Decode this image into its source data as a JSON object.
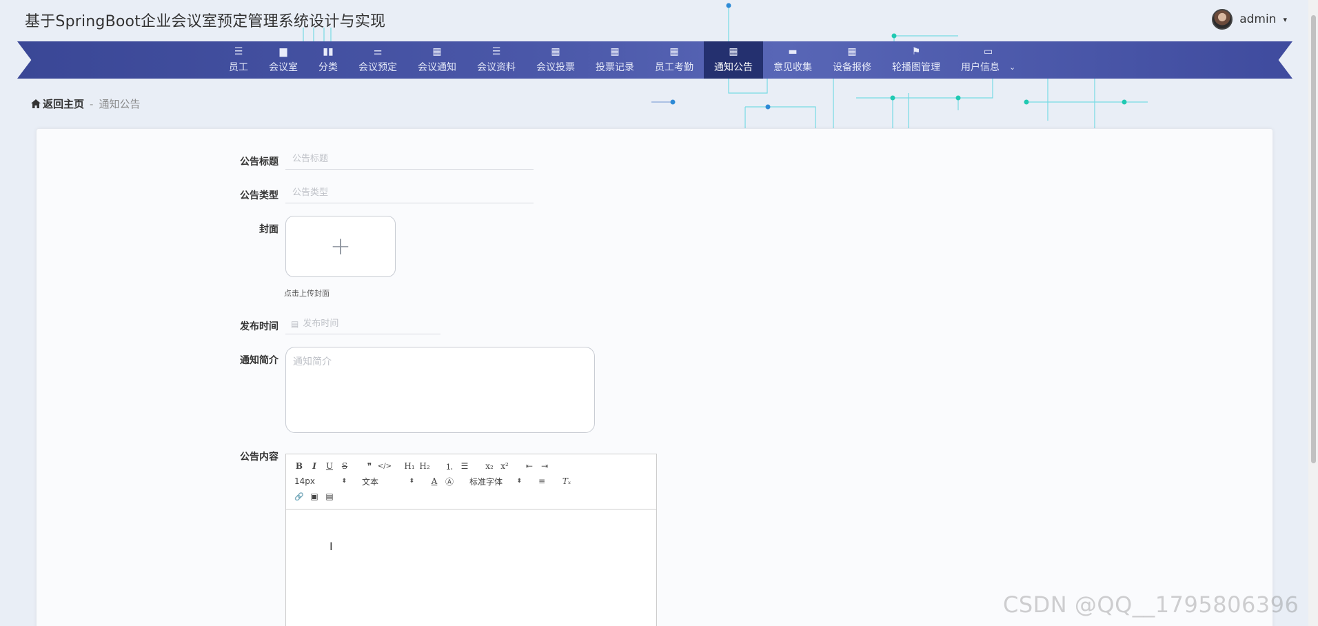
{
  "header": {
    "site_title": "基于SpringBoot企业会议室预定管理系统设计与实现",
    "username": "admin",
    "username_caret": "▾"
  },
  "nav": {
    "items": [
      {
        "label": "员工",
        "icon": "list-icon",
        "glyph": "☰"
      },
      {
        "label": "会议室",
        "icon": "chat-icon",
        "glyph": "▆"
      },
      {
        "label": "分类",
        "icon": "bar-chart-icon",
        "glyph": "▮▮"
      },
      {
        "label": "会议预定",
        "icon": "sliders-icon",
        "glyph": "⚌"
      },
      {
        "label": "会议通知",
        "icon": "grid-icon",
        "glyph": "▦"
      },
      {
        "label": "会议资料",
        "icon": "list-icon",
        "glyph": "☰"
      },
      {
        "label": "会议投票",
        "icon": "grid-icon",
        "glyph": "▦"
      },
      {
        "label": "投票记录",
        "icon": "grid-icon",
        "glyph": "▦"
      },
      {
        "label": "员工考勤",
        "icon": "grid-icon",
        "glyph": "▦"
      },
      {
        "label": "通知公告",
        "icon": "grid-icon",
        "glyph": "▦",
        "active": true
      },
      {
        "label": "意见收集",
        "icon": "briefcase-icon",
        "glyph": "▬"
      },
      {
        "label": "设备报修",
        "icon": "grid-icon",
        "glyph": "▦"
      },
      {
        "label": "轮播图管理",
        "icon": "flag-icon",
        "glyph": "⚑"
      },
      {
        "label": "用户信息",
        "icon": "window-icon",
        "glyph": "▭",
        "has_dropdown": true
      }
    ],
    "dropdown_caret": "⌄"
  },
  "breadcrumb": {
    "home_label": "返回主页",
    "separator": "-",
    "current": "通知公告"
  },
  "form": {
    "title_label": "公告标题",
    "title_placeholder": "公告标题",
    "type_label": "公告类型",
    "type_placeholder": "公告类型",
    "cover_label": "封面",
    "cover_hint": "点击上传封面",
    "publish_time_label": "发布时间",
    "publish_time_placeholder": "发布时间",
    "intro_label": "通知简介",
    "intro_placeholder": "通知简介",
    "content_label": "公告内容"
  },
  "editor": {
    "font_size": "14px",
    "block_format": "文本",
    "font_family": "标准字体",
    "buttons": {
      "bold": "B",
      "italic": "I",
      "underline": "U",
      "strike": "S",
      "quote": "❞",
      "code": "</>",
      "h1": "H₁",
      "h2": "H₂",
      "ordered_list": "⒈",
      "bullet_list": "☰",
      "subscript": "x₂",
      "superscript": "x²",
      "outdent": "⇤",
      "indent": "⇥",
      "font_color": "A",
      "background": "Ⓐ",
      "align": "≡",
      "clean": "Tₓ",
      "link": "🔗",
      "image": "▣",
      "video": "▤"
    }
  },
  "watermark": "CSDN @QQ__1795806396",
  "colors": {
    "nav_bg": "#4a57a8",
    "nav_active": "#24306f",
    "page_bg": "#e9eef6"
  }
}
